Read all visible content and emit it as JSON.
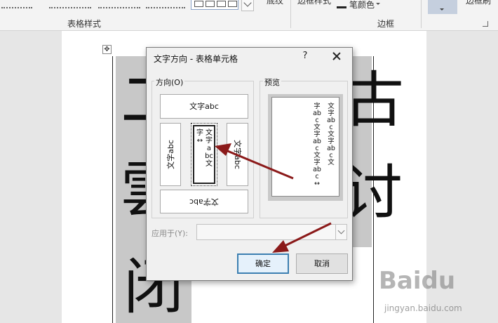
{
  "ribbon": {
    "group_table_styles": "表格样式",
    "group_borders": "边框",
    "pen_color": "笔颜色",
    "fragment_1": "底纹",
    "fragment_2": "边框样式",
    "fragment_3": "边框刷"
  },
  "document": {
    "move_handle": "✥",
    "chars": [
      "二",
      "雲",
      "闭",
      "古",
      "讨"
    ]
  },
  "dialog": {
    "title": "文字方向 - 表格单元格",
    "help": "?",
    "direction_legend": "方向(O)",
    "preview_legend": "预览",
    "options": {
      "horizontal": "文字abc",
      "rotated_left": "文字abc",
      "vertical_a": "文字abc文",
      "vertical_b": "字↔",
      "rotated_right": "文字abc",
      "flipped": "文字abc"
    },
    "preview_lines": [
      "文字abc文字abc文",
      "字abc文字abc文字abc↔"
    ],
    "apply_label": "应用于(Y):",
    "apply_value": "",
    "ok_label": "确定",
    "cancel_label": "取消"
  },
  "watermark": {
    "logo": "Baidu",
    "url": "jingyan.baidu.com"
  },
  "colors": {
    "arrow": "#8b1a1a",
    "ok_border": "#3c7fb1",
    "cell_shading": "#c8c8c8"
  }
}
